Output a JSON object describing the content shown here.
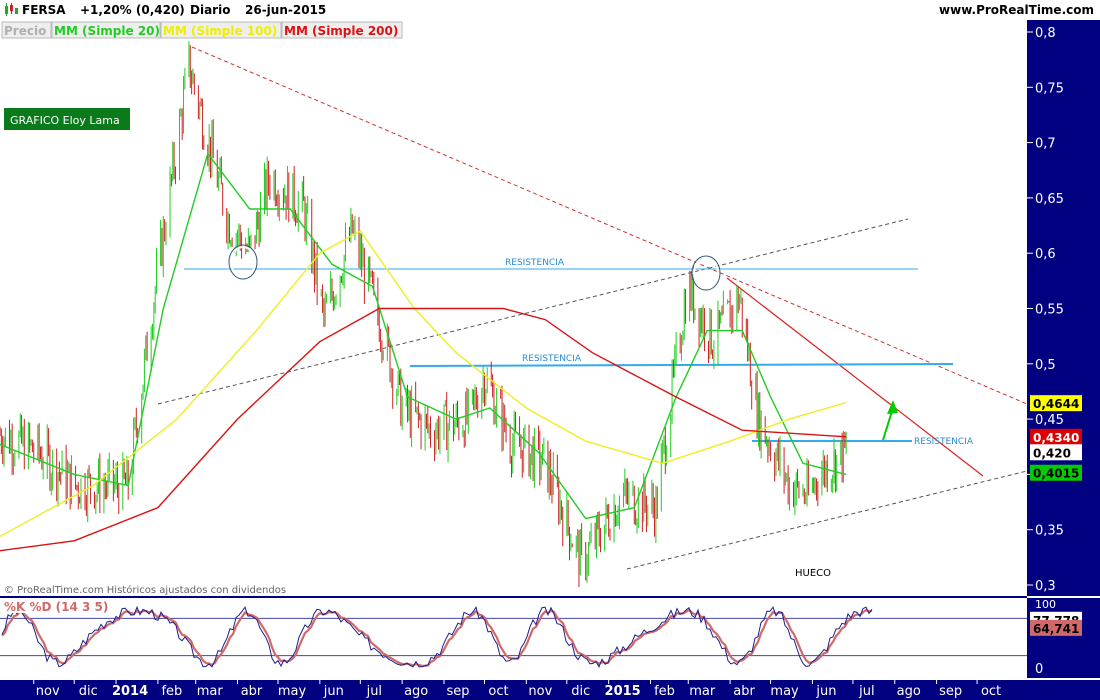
{
  "header": {
    "ticker": "FERSA",
    "change": "+1,20% (0,420)",
    "period": "Diario",
    "date": "26-jun-2015",
    "site": "www.ProRealTime.com",
    "legend_price": "Precio",
    "legend_ma20": "MM (Simple 20)",
    "legend_ma100": "MM (Simple 100)",
    "legend_ma200": "MM (Simple 200)"
  },
  "annotations": {
    "author_box": "GRAFICO Eloy Lama",
    "resistance_1": "RESISTENCIA",
    "resistance_2": "RESISTENCIA",
    "resistance_3": "RESISTENCIA",
    "gap": "HUECO",
    "copyright": "© ProRealTime.com Históricos ajustados con dividendos"
  },
  "colors": {
    "up": "#22cc22",
    "down": "#cc2222",
    "ma20": "#22cc22",
    "ma100": "#eeee22",
    "ma200": "#dd1111",
    "resistance": "#33aaee",
    "axis_bg": "#000080",
    "stoch_k": "#1e1e8c",
    "stoch_d": "#d26969"
  },
  "chart_data": [
    {
      "type": "line",
      "title": "FERSA Diario",
      "x": [
        "nov",
        "dic",
        "2014",
        "feb",
        "mar",
        "abr",
        "may",
        "jun",
        "jul",
        "ago",
        "sep",
        "oct",
        "nov",
        "dic",
        "2015",
        "feb",
        "mar",
        "abr",
        "may",
        "jun",
        "jul",
        "ago",
        "sep",
        "oct"
      ],
      "ylim": [
        0.29,
        0.82
      ],
      "y_ticks": [
        "0,3",
        "0,35",
        "0,4",
        "0,45",
        "0,5",
        "0,55",
        "0,6",
        "0,65",
        "0,7",
        "0,75",
        "0,8"
      ],
      "price_anchors": [
        {
          "date": "2013-10-01",
          "value": 0.44
        },
        {
          "date": "2013-11-05",
          "value": 0.42
        },
        {
          "date": "2013-12-01",
          "value": 0.39
        },
        {
          "date": "2014-01-10",
          "value": 0.39
        },
        {
          "date": "2014-01-29",
          "value": 0.56
        },
        {
          "date": "2014-02-24",
          "value": 0.77
        },
        {
          "date": "2014-03-25",
          "value": 0.63
        },
        {
          "date": "2014-04-10",
          "value": 0.6
        },
        {
          "date": "2014-04-25",
          "value": 0.67
        },
        {
          "date": "2014-05-20",
          "value": 0.64
        },
        {
          "date": "2014-06-04",
          "value": 0.54
        },
        {
          "date": "2014-06-25",
          "value": 0.62
        },
        {
          "date": "2014-07-15",
          "value": 0.54
        },
        {
          "date": "2014-08-01",
          "value": 0.46
        },
        {
          "date": "2014-08-22",
          "value": 0.44
        },
        {
          "date": "2014-09-20",
          "value": 0.45
        },
        {
          "date": "2014-10-01",
          "value": 0.49
        },
        {
          "date": "2014-10-20",
          "value": 0.43
        },
        {
          "date": "2014-11-15",
          "value": 0.41
        },
        {
          "date": "2014-12-12",
          "value": 0.32
        },
        {
          "date": "2015-01-10",
          "value": 0.38
        },
        {
          "date": "2015-02-05",
          "value": 0.37
        },
        {
          "date": "2015-02-28",
          "value": 0.57
        },
        {
          "date": "2015-03-20",
          "value": 0.52
        },
        {
          "date": "2015-04-08",
          "value": 0.56
        },
        {
          "date": "2015-04-22",
          "value": 0.45
        },
        {
          "date": "2015-05-15",
          "value": 0.39
        },
        {
          "date": "2015-05-30",
          "value": 0.38
        },
        {
          "date": "2015-06-05",
          "value": 0.4
        },
        {
          "date": "2015-06-26",
          "value": 0.42
        }
      ],
      "series": [
        {
          "name": "MM (Simple 20)",
          "points": [
            [
              "2013-10-01",
              0.43
            ],
            [
              "2013-12-01",
              0.4
            ],
            [
              "2014-01-10",
              0.39
            ],
            [
              "2014-02-05",
              0.55
            ],
            [
              "2014-03-10",
              0.69
            ],
            [
              "2014-04-10",
              0.64
            ],
            [
              "2014-05-10",
              0.64
            ],
            [
              "2014-06-10",
              0.59
            ],
            [
              "2014-07-10",
              0.57
            ],
            [
              "2014-08-05",
              0.47
            ],
            [
              "2014-09-10",
              0.45
            ],
            [
              "2014-10-05",
              0.46
            ],
            [
              "2014-11-10",
              0.42
            ],
            [
              "2014-12-15",
              0.36
            ],
            [
              "2015-01-20",
              0.37
            ],
            [
              "2015-02-20",
              0.47
            ],
            [
              "2015-03-15",
              0.53
            ],
            [
              "2015-04-10",
              0.53
            ],
            [
              "2015-05-01",
              0.47
            ],
            [
              "2015-05-25",
              0.41
            ],
            [
              "2015-06-26",
              0.4
            ]
          ]
        },
        {
          "name": "MM (Simple 100)",
          "points": [
            [
              "2013-10-01",
              0.34
            ],
            [
              "2013-12-15",
              0.39
            ],
            [
              "2014-02-15",
              0.45
            ],
            [
              "2014-04-15",
              0.53
            ],
            [
              "2014-06-01",
              0.6
            ],
            [
              "2014-07-01",
              0.62
            ],
            [
              "2014-08-10",
              0.55
            ],
            [
              "2014-09-10",
              0.51
            ],
            [
              "2014-11-01",
              0.46
            ],
            [
              "2014-12-15",
              0.43
            ],
            [
              "2015-02-10",
              0.41
            ],
            [
              "2015-04-01",
              0.43
            ],
            [
              "2015-05-15",
              0.45
            ],
            [
              "2015-06-26",
              0.465
            ]
          ]
        },
        {
          "name": "MM (Simple 200)",
          "points": [
            [
              "2013-10-01",
              0.33
            ],
            [
              "2013-12-01",
              0.34
            ],
            [
              "2014-02-01",
              0.37
            ],
            [
              "2014-04-01",
              0.45
            ],
            [
              "2014-06-01",
              0.52
            ],
            [
              "2014-07-15",
              0.55
            ],
            [
              "2014-09-01",
              0.55
            ],
            [
              "2014-10-15",
              0.55
            ],
            [
              "2014-11-15",
              0.54
            ],
            [
              "2014-12-20",
              0.51
            ],
            [
              "2015-02-20",
              0.47
            ],
            [
              "2015-04-10",
              0.44
            ],
            [
              "2015-06-26",
              0.434
            ]
          ]
        }
      ],
      "resistance_levels": [
        0.587,
        0.5,
        0.43
      ],
      "last_values": [
        {
          "label": "0,4644",
          "value": 0.4644,
          "color": "#ffff00"
        },
        {
          "label": "0,4340",
          "value": 0.434,
          "color": "#dd0000"
        },
        {
          "label": "0,420",
          "value": 0.42,
          "color": "#ffffff"
        },
        {
          "label": "0,4015",
          "value": 0.4015,
          "color": "#00cc00"
        }
      ]
    },
    {
      "type": "line",
      "title": "%K %D (14 3 5)",
      "ylim": [
        0,
        100
      ],
      "y_ticks": [
        "0"
      ],
      "series": [
        {
          "name": "%K",
          "last": 77.778
        },
        {
          "name": "%D",
          "last": 64.741
        }
      ],
      "last_labels": [
        "77,778",
        "64,741"
      ],
      "top_label": "100"
    }
  ]
}
